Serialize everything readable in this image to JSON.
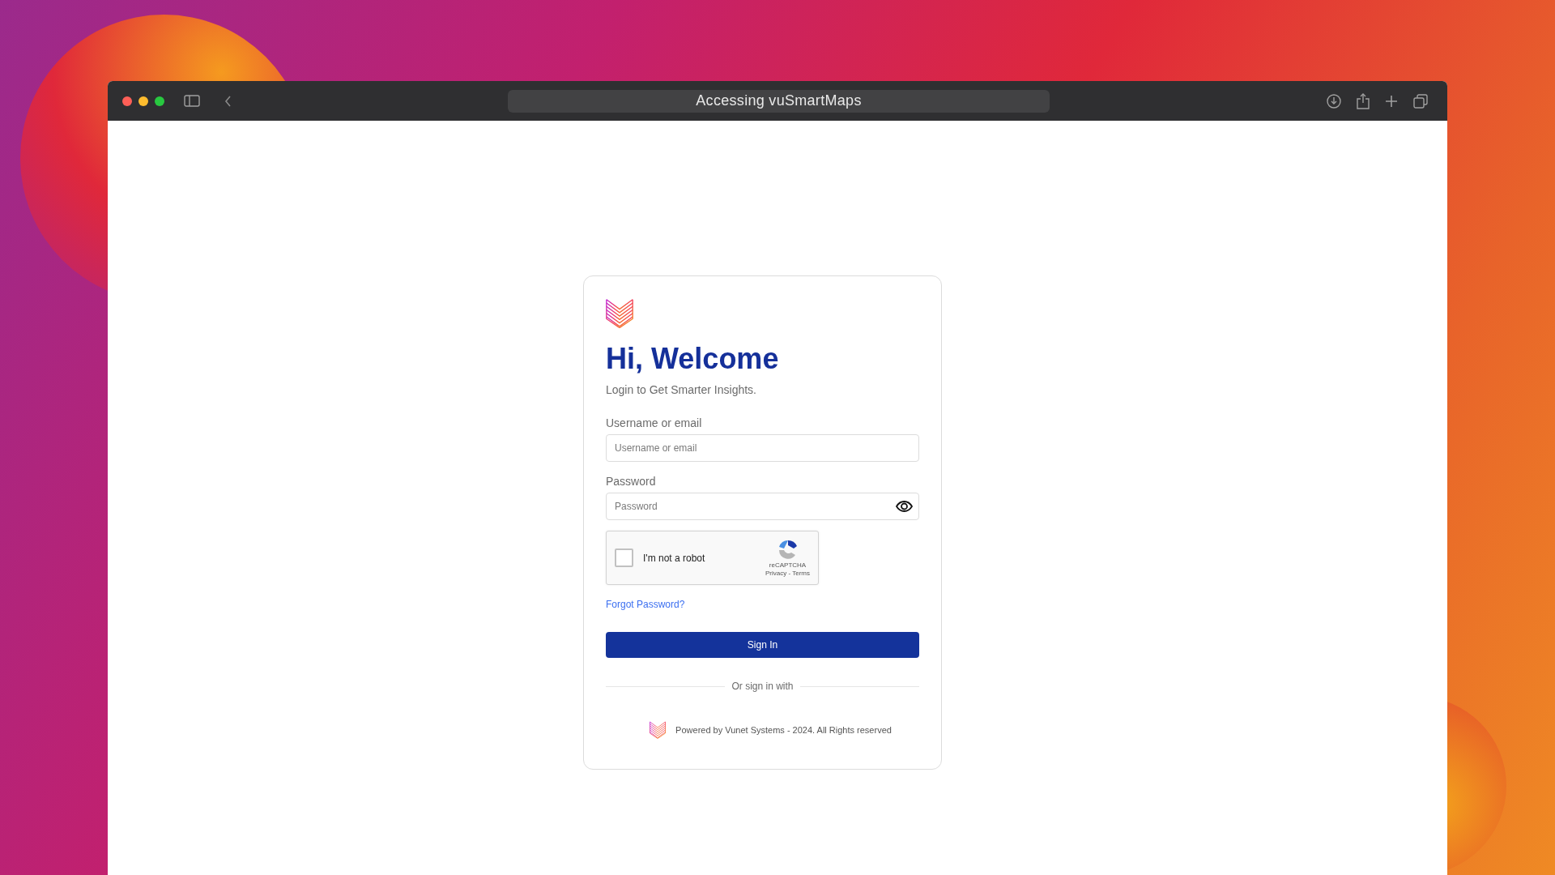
{
  "browser": {
    "title": "Accessing vuSmartMaps"
  },
  "login": {
    "heading": "Hi, Welcome",
    "subtitle": "Login to Get Smarter Insights.",
    "fields": [
      {
        "label": "Username or email",
        "placeholder": "Username or email",
        "kind": "text"
      },
      {
        "label": "Password",
        "placeholder": "Password",
        "kind": "password"
      }
    ],
    "captcha": {
      "label": "I'm not a robot",
      "checked": false,
      "brand": "reCAPTCHA",
      "links": "Privacy - Terms"
    },
    "forgot_link": "Forgot Password?",
    "submit": "Sign In",
    "divider": "Or sign in with",
    "footer": "Powered by Vunet Systems - 2024. All Rights reserved"
  }
}
